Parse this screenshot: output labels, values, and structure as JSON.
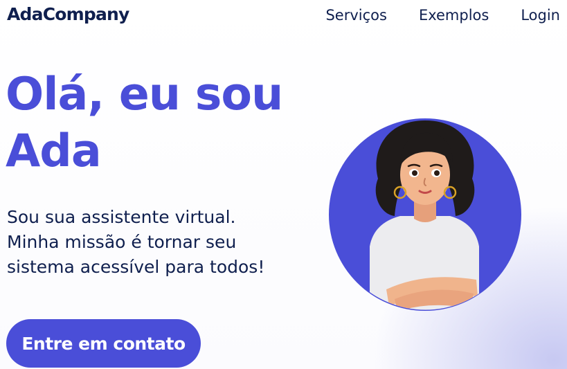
{
  "header": {
    "logo": "AdaCompany",
    "nav": [
      {
        "label": "Serviços"
      },
      {
        "label": "Exemplos"
      },
      {
        "label": "Login"
      }
    ]
  },
  "hero": {
    "title_lines": [
      "Olá, eu sou",
      "Ada"
    ],
    "subtitle_lines": [
      "Sou sua assistente virtual.",
      "Minha missão é tornar seu",
      "sistema acessível para todos!"
    ],
    "cta_label": "Entre em contato"
  },
  "avatar": {
    "icon": "woman-avatar-icon"
  },
  "colors": {
    "brand": "#4a4ed8",
    "text_dark": "#0f1f4e",
    "background": "#ffffff",
    "accent_glow": "#c0c2f0"
  }
}
